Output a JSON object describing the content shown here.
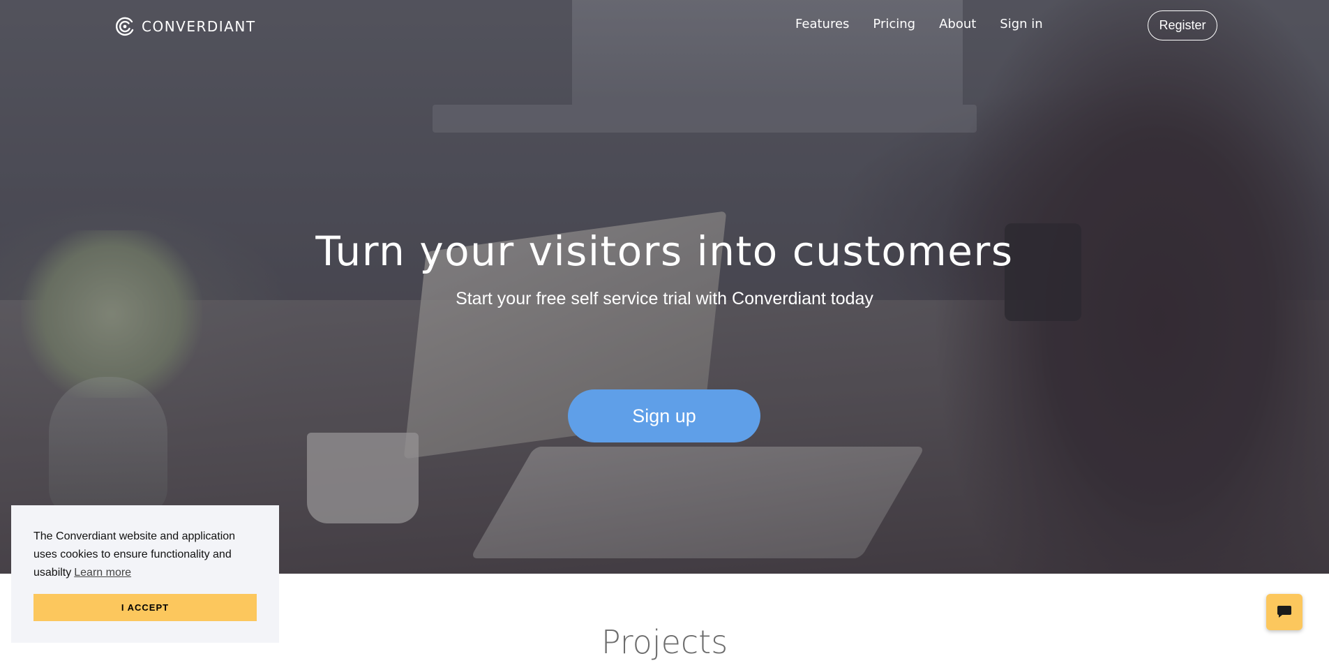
{
  "brand": {
    "name": "CONVERDIANT",
    "logo_icon": "spiral-c-logo-icon"
  },
  "nav": {
    "items": [
      {
        "label": "Features"
      },
      {
        "label": "Pricing"
      },
      {
        "label": "About"
      },
      {
        "label": "Sign in"
      }
    ],
    "register_label": "Register"
  },
  "hero": {
    "headline": "Turn your visitors into customers",
    "subheadline": "Start your free self service trial with Converdiant today",
    "signup_label": "Sign up"
  },
  "section": {
    "title": "Projects"
  },
  "cookie_banner": {
    "message": "The Converdiant website and application uses cookies to ensure functionality and usabilty",
    "learn_more_label": "Learn more",
    "accept_label": "I ACCEPT"
  },
  "chat": {
    "icon": "chat-bubble-icon"
  },
  "colors": {
    "accent_blue": "#5f9fe8",
    "accent_yellow": "#fcc75d",
    "cookie_bg": "#f3f4f8"
  }
}
